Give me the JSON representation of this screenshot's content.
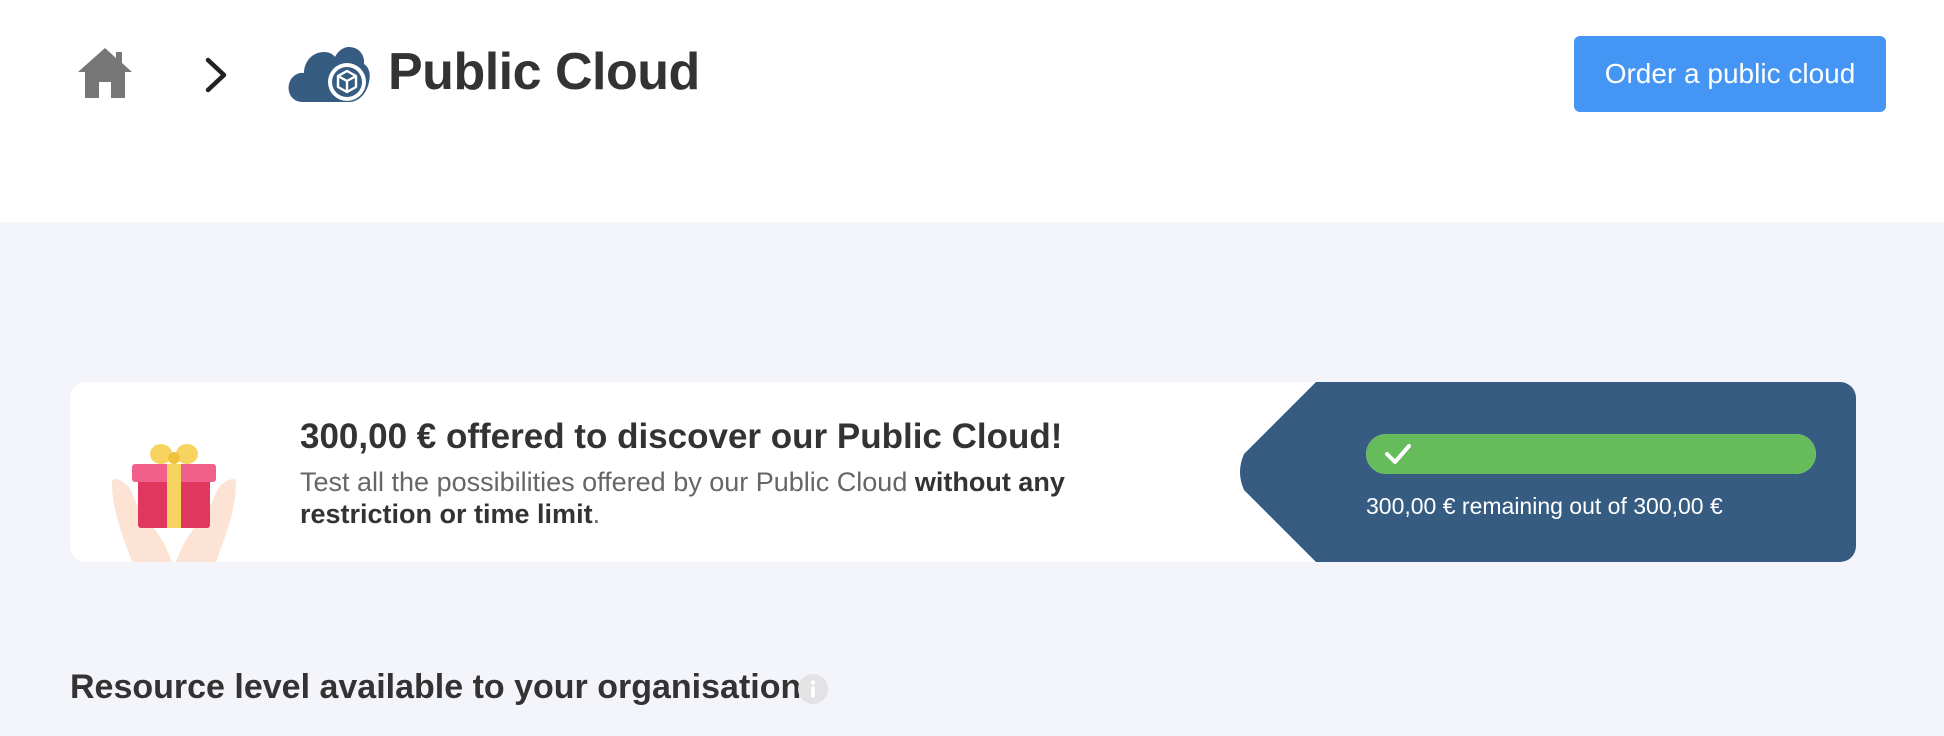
{
  "header": {
    "title": "Public Cloud",
    "order_button_label": "Order a public cloud",
    "icons": [
      "home-icon",
      "chevron-right-icon",
      "cloud-cube-icon"
    ]
  },
  "offer": {
    "title": "300,00 € offered to discover our Public Cloud!",
    "desc_plain": "Test all the possibilities offered by our Public Cloud ",
    "desc_bold": "without any restriction or time limit",
    "desc_end": ".",
    "icon": "gift-icon"
  },
  "credit": {
    "remaining_text": "300,00 € remaining out of 300,00 €",
    "remaining_fraction": 1.0,
    "icon": "check-icon"
  },
  "resources": {
    "title": "Resource level available to your organisation",
    "icon": "info-icon"
  },
  "colors": {
    "accent": "#4596f4",
    "panel": "#365c82",
    "progress": "#66bb5a",
    "background": "#f4f5fa"
  }
}
